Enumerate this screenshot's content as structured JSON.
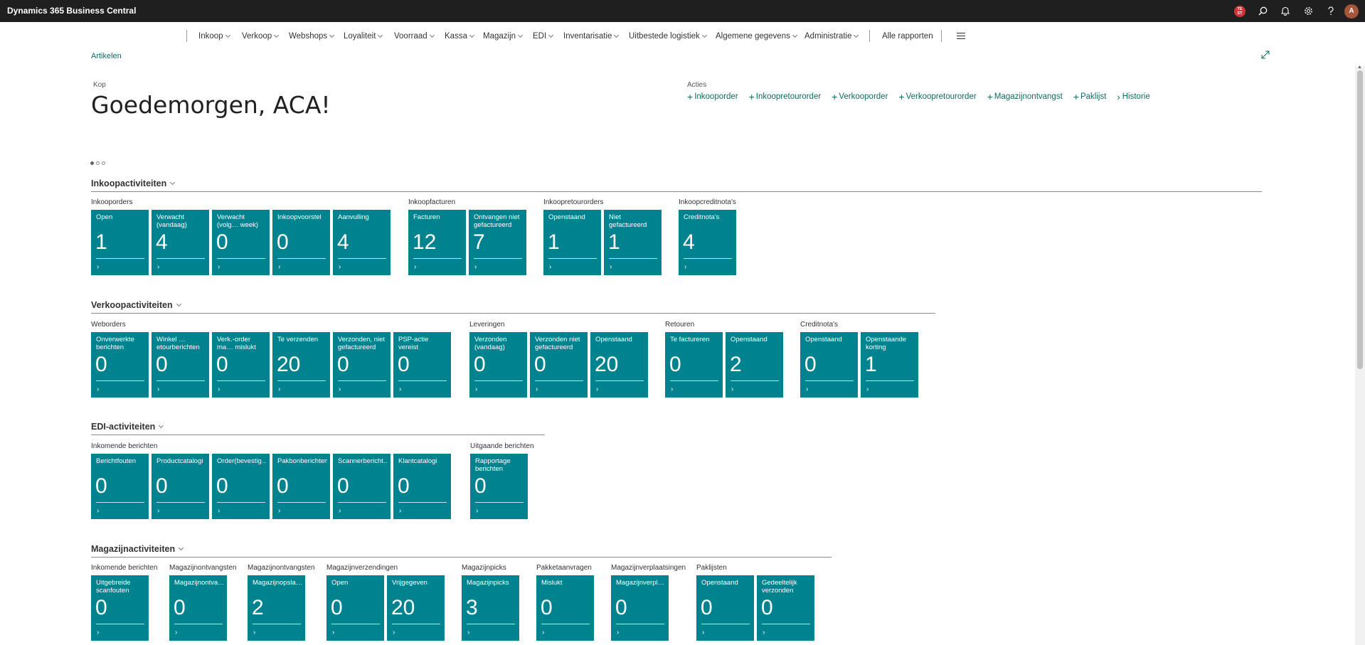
{
  "app": {
    "title": "Dynamics 365 Business Central"
  },
  "topbar": {
    "badge_line1": "TE",
    "badge_line2": "ST",
    "avatar_initial": "A"
  },
  "nav": {
    "items": [
      "Inkoop",
      "Verkoop",
      "Webshops",
      "Loyaliteit",
      "Voorraad",
      "Kassa",
      "Magazijn",
      "EDI",
      "Inventarisatie",
      "Uitbestede logistiek",
      "Algemene gegevens",
      "Administratie"
    ],
    "all_reports": "Alle rapporten"
  },
  "breadcrumb": "Artikelen",
  "header": {
    "kop_label": "Kop",
    "greeting": "Goedemorgen, ACA!"
  },
  "actions": {
    "label": "Acties",
    "items": [
      "Inkooporder",
      "Inkoopretourorder",
      "Verkooporder",
      "Verkoopretourorder",
      "Magazijnontvangst",
      "Paklijst",
      "Historie"
    ]
  },
  "sections": [
    {
      "title": "Inkoopactiviteiten",
      "groups": [
        {
          "label": "Inkooporders",
          "tiles": [
            {
              "title": "Open",
              "value": "1"
            },
            {
              "title": "Verwacht (vandaag)",
              "value": "4"
            },
            {
              "title": "Verwacht (volg… week)",
              "value": "0"
            },
            {
              "title": "Inkoopvoorstel",
              "value": "0"
            },
            {
              "title": "Aanvulling",
              "value": "4"
            }
          ]
        },
        {
          "label": "Inkoopfacturen",
          "tiles": [
            {
              "title": "Facturen",
              "value": "12"
            },
            {
              "title": "Ontvangen niet gefactureerd",
              "value": "7"
            }
          ]
        },
        {
          "label": "Inkoopretourorders",
          "tiles": [
            {
              "title": "Openstaand",
              "value": "1"
            },
            {
              "title": "Niet gefactureerd",
              "value": "1"
            }
          ]
        },
        {
          "label": "Inkoopcreditnota's",
          "tiles": [
            {
              "title": "Creditnota's",
              "value": "4"
            }
          ]
        }
      ]
    },
    {
      "title": "Verkoopactiviteiten",
      "groups": [
        {
          "label": "Weborders",
          "tiles": [
            {
              "title": "Onverwerkte berichten",
              "value": "0"
            },
            {
              "title": "Winkel …etourberichten",
              "value": "0"
            },
            {
              "title": "Verk.-order ma… mislukt",
              "value": "0"
            },
            {
              "title": "Te verzenden",
              "value": "20"
            },
            {
              "title": "Verzonden, niet gefactureerd",
              "value": "0"
            },
            {
              "title": "PSP-actie vereist",
              "value": "0"
            }
          ]
        },
        {
          "label": "Leveringen",
          "tiles": [
            {
              "title": "Verzonden (vandaag)",
              "value": "0"
            },
            {
              "title": "Verzonden niet gefactureerd",
              "value": "0"
            },
            {
              "title": "Openstaand",
              "value": "20"
            }
          ]
        },
        {
          "label": "Retouren",
          "tiles": [
            {
              "title": "Te factureren",
              "value": "0"
            },
            {
              "title": "Openstaand",
              "value": "2"
            }
          ]
        },
        {
          "label": "Creditnota's",
          "tiles": [
            {
              "title": "Openstaand",
              "value": "0"
            },
            {
              "title": "Openstaande korting",
              "value": "1"
            }
          ]
        }
      ]
    },
    {
      "title": "EDI-activiteiten",
      "groups": [
        {
          "label": "Inkomende berichten",
          "tiles": [
            {
              "title": "Berichtfouten",
              "value": "0"
            },
            {
              "title": "Productcatalogi",
              "value": "0"
            },
            {
              "title": "Order(bevestig…",
              "value": "0"
            },
            {
              "title": "Pakbonberichten",
              "value": "0"
            },
            {
              "title": "Scannerbericht…",
              "value": "0"
            },
            {
              "title": "Klantcatalogi",
              "value": "0"
            }
          ]
        },
        {
          "label": "Uitgaande berichten",
          "tiles": [
            {
              "title": "Rapportage berichten",
              "value": "0"
            }
          ]
        }
      ]
    },
    {
      "title": "Magazijnactiviteiten",
      "groups": [
        {
          "label": "Inkomende berichten",
          "tiles": [
            {
              "title": "Uitgebreide scanfouten",
              "value": "0"
            }
          ]
        },
        {
          "label": "Magazijnontvangsten",
          "tiles": [
            {
              "title": "Magazijnontva…",
              "value": "0"
            }
          ]
        },
        {
          "label": "Magazijnontvangsten",
          "tiles": [
            {
              "title": "Magazijnopsla…",
              "value": "2"
            }
          ]
        },
        {
          "label": "Magazijnverzendingen",
          "tiles": [
            {
              "title": "Open",
              "value": "0"
            },
            {
              "title": "Vrijgegeven",
              "value": "20"
            }
          ]
        },
        {
          "label": "Magazijnpicks",
          "tiles": [
            {
              "title": "Magazijnpicks",
              "value": "3"
            }
          ]
        },
        {
          "label": "Pakketaanvragen",
          "tiles": [
            {
              "title": "Mislukt",
              "value": "0"
            }
          ]
        },
        {
          "label": "Magazijnverplaatsingen",
          "tiles": [
            {
              "title": "Magazijnverpl…",
              "value": "0"
            }
          ]
        },
        {
          "label": "Paklijsten",
          "tiles": [
            {
              "title": "Openstaand",
              "value": "0"
            },
            {
              "title": "Gedeeltelijk verzonden",
              "value": "0"
            }
          ]
        }
      ]
    }
  ],
  "colors": {
    "tile": "#00838f",
    "link": "#0f6b63",
    "topbar": "#1f1f1f"
  }
}
